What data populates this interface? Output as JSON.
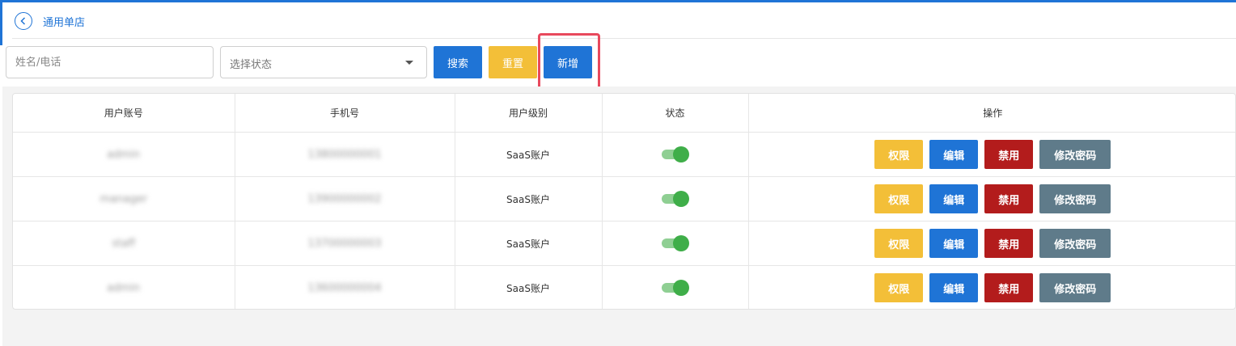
{
  "header": {
    "title": "通用单店",
    "back_icon": "chevron-left-icon"
  },
  "filters": {
    "name_placeholder": "姓名/电话",
    "status_placeholder": "选择状态",
    "search_label": "搜索",
    "reset_label": "重置",
    "add_label": "新增"
  },
  "colors": {
    "primary": "#1f74d6",
    "warning": "#f3bf38",
    "danger": "#b31c1c",
    "secondary": "#5f7b8a",
    "switch_on": "#3fae49",
    "highlight": "#e8495d"
  },
  "table": {
    "headers": [
      "用户账号",
      "手机号",
      "用户级别",
      "状态",
      "操作"
    ],
    "rows": [
      {
        "account": "admin",
        "phone": "13800000001",
        "level": "SaaS账户",
        "enabled": true
      },
      {
        "account": "manager",
        "phone": "13900000002",
        "level": "SaaS账户",
        "enabled": true
      },
      {
        "account": "staff",
        "phone": "13700000003",
        "level": "SaaS账户",
        "enabled": true
      },
      {
        "account": "admin",
        "phone": "13600000004",
        "level": "SaaS账户",
        "enabled": true
      }
    ],
    "actions": {
      "perm": "权限",
      "edit": "编辑",
      "disable": "禁用",
      "password": "修改密码"
    }
  }
}
